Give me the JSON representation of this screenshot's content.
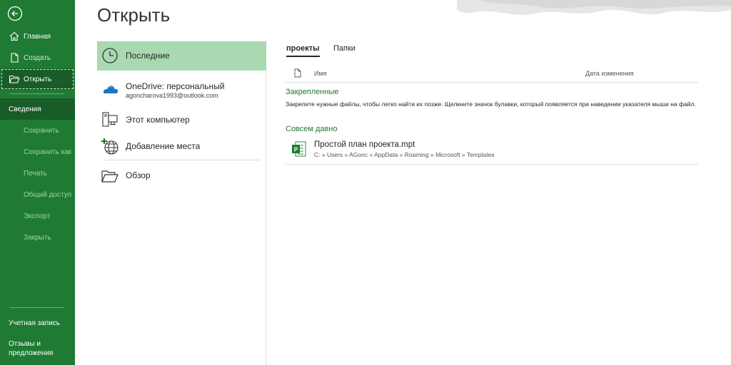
{
  "sidebar": {
    "items": [
      {
        "label": "Главная",
        "icon": "home-icon"
      },
      {
        "label": "Создать",
        "icon": "new-document-icon"
      },
      {
        "label": "Открыть",
        "icon": "open-folder-icon"
      },
      {
        "label": "Сведения"
      },
      {
        "label": "Сохранить"
      },
      {
        "label": "Сохранить как"
      },
      {
        "label": "Печать"
      },
      {
        "label": "Общий доступ"
      },
      {
        "label": "Экспорт"
      },
      {
        "label": "Закрыть"
      }
    ],
    "account_label": "Учетная запись",
    "feedback_line1": "Отзывы и",
    "feedback_line2": "предложения"
  },
  "header": {
    "title": "Открыть"
  },
  "locations": {
    "recent": "Последние",
    "onedrive": "OneDrive: персональный",
    "onedrive_email": "agoncharova1993@outlook.com",
    "this_pc": "Этот компьютер",
    "add_place": "Добавление места",
    "browse": "Обзор"
  },
  "files": {
    "tabs": [
      "проекты",
      "Папки"
    ],
    "columns": {
      "name": "Имя",
      "modified": "Дата изменения"
    },
    "pinned_title": "Закрепленные",
    "pinned_hint": "Закрепите нужные файлы, чтобы легко найти их позже. Щелкните значок булавки, который появляется при наведении указателя мыши на файл.",
    "older_title": "Совсем давно",
    "items": [
      {
        "name": "Простой план проекта.mpt",
        "path": "C: » Users » AGonc » AppData » Roaming » Microsoft » Templates",
        "icon": "project-file-icon"
      }
    ]
  },
  "colors": {
    "sidebar": "#1f7a33",
    "selected_location": "#a9d9b1",
    "accent_text": "#1f7a33"
  }
}
